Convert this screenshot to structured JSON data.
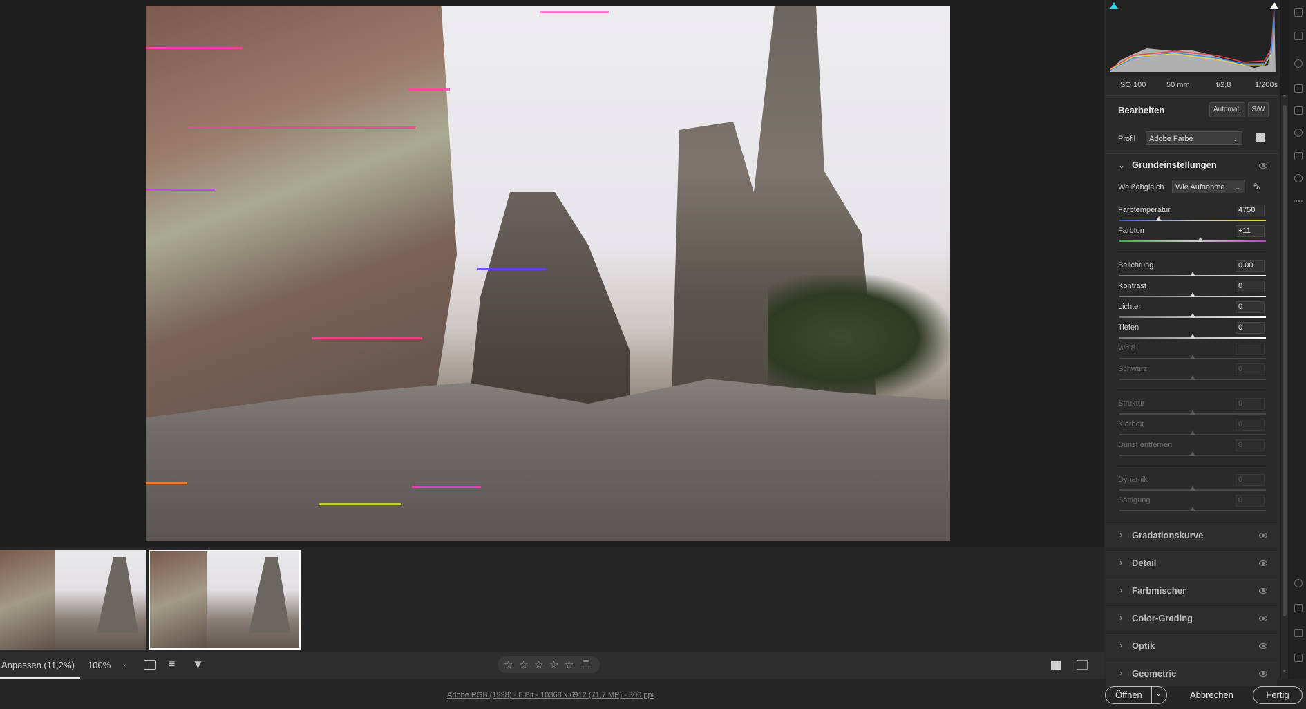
{
  "filmstrip": {
    "thumbnails": [
      "thumb-1",
      "thumb-2"
    ]
  },
  "toolbar": {
    "fit_label": "Anpassen (11,2%)",
    "zoom_label": "100%",
    "rating_stars": 5
  },
  "status": {
    "file_info": "Adobe RGB (1998) - 8 Bit - 10368 x 6912 (71,7 MP) - 300 ppi",
    "open_label": "Öffnen",
    "cancel_label": "Abbrechen",
    "done_label": "Fertig"
  },
  "camera": {
    "iso": "ISO 100",
    "focal": "50 mm",
    "aperture": "f/2,8",
    "shutter": "1/200s"
  },
  "edit": {
    "title": "Bearbeiten",
    "auto_label": "Automat.",
    "bw_label": "S/W",
    "profile_label": "Profil",
    "profile_value": "Adobe Farbe"
  },
  "basic": {
    "title": "Grundeinstellungen",
    "wb_label": "Weißabgleich",
    "wb_value": "Wie Aufnahme",
    "sliders": [
      {
        "label": "Farbtemperatur",
        "value": "4750",
        "pos": 0.27,
        "enabled": true
      },
      {
        "label": "Farbton",
        "value": "+11",
        "pos": 0.55,
        "enabled": true
      },
      {
        "label": "Belichtung",
        "value": "0.00",
        "pos": 0.5,
        "enabled": true
      },
      {
        "label": "Kontrast",
        "value": "0",
        "pos": 0.5,
        "enabled": true
      },
      {
        "label": "Lichter",
        "value": "0",
        "pos": 0.5,
        "enabled": true
      },
      {
        "label": "Tiefen",
        "value": "0",
        "pos": 0.5,
        "enabled": true
      },
      {
        "label": "Weiß",
        "value": "",
        "pos": 0.5,
        "enabled": false
      },
      {
        "label": "Schwarz",
        "value": "0",
        "pos": 0.5,
        "enabled": false
      },
      {
        "label": "Struktur",
        "value": "0",
        "pos": 0.5,
        "enabled": false
      },
      {
        "label": "Klarheit",
        "value": "0",
        "pos": 0.5,
        "enabled": false
      },
      {
        "label": "Dunst entfernen",
        "value": "0",
        "pos": 0.5,
        "enabled": false
      },
      {
        "label": "Dynamik",
        "value": "0",
        "pos": 0.5,
        "enabled": false
      },
      {
        "label": "Sättigung",
        "value": "0",
        "pos": 0.5,
        "enabled": false
      }
    ]
  },
  "sections": [
    "Gradationskurve",
    "Detail",
    "Farbmischer",
    "Color-Grading",
    "Optik",
    "Geometrie"
  ],
  "colors": {
    "accent_cyan": "#2fd0e0",
    "panel_bg": "#2a2a2a",
    "canvas_bg": "#1e1e1e"
  }
}
